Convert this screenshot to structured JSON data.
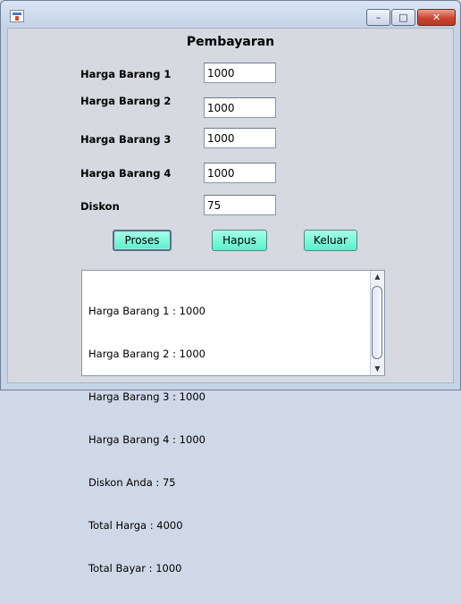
{
  "window": {
    "title": "",
    "app_icon": "java-cup-icon",
    "controls": {
      "minimize": "–",
      "maximize": "□",
      "close": "✕"
    }
  },
  "form": {
    "heading": "Pembayaran",
    "fields": [
      {
        "label": "Harga Barang 1",
        "value": "1000"
      },
      {
        "label": "Harga Barang 2",
        "value": "1000"
      },
      {
        "label": "Harga Barang 3",
        "value": "1000"
      },
      {
        "label": "Harga Barang 4",
        "value": "1000"
      },
      {
        "label": "Diskon",
        "value": "75"
      }
    ]
  },
  "buttons": {
    "proses": "Proses",
    "hapus": "Hapus",
    "keluar": "Keluar"
  },
  "output": {
    "lines": [
      "Harga Barang 1 : 1000",
      "Harga Barang 2 : 1000",
      "Harga Barang 3 : 1000",
      "Harga Barang 4 : 1000",
      "Diskon Anda : 75",
      "Total Harga : 4000",
      "Total Bayar : 1000"
    ]
  },
  "colors": {
    "button_fill": "#5bf0cc",
    "panel": "#d6d9df",
    "close_button": "#c9452f"
  }
}
